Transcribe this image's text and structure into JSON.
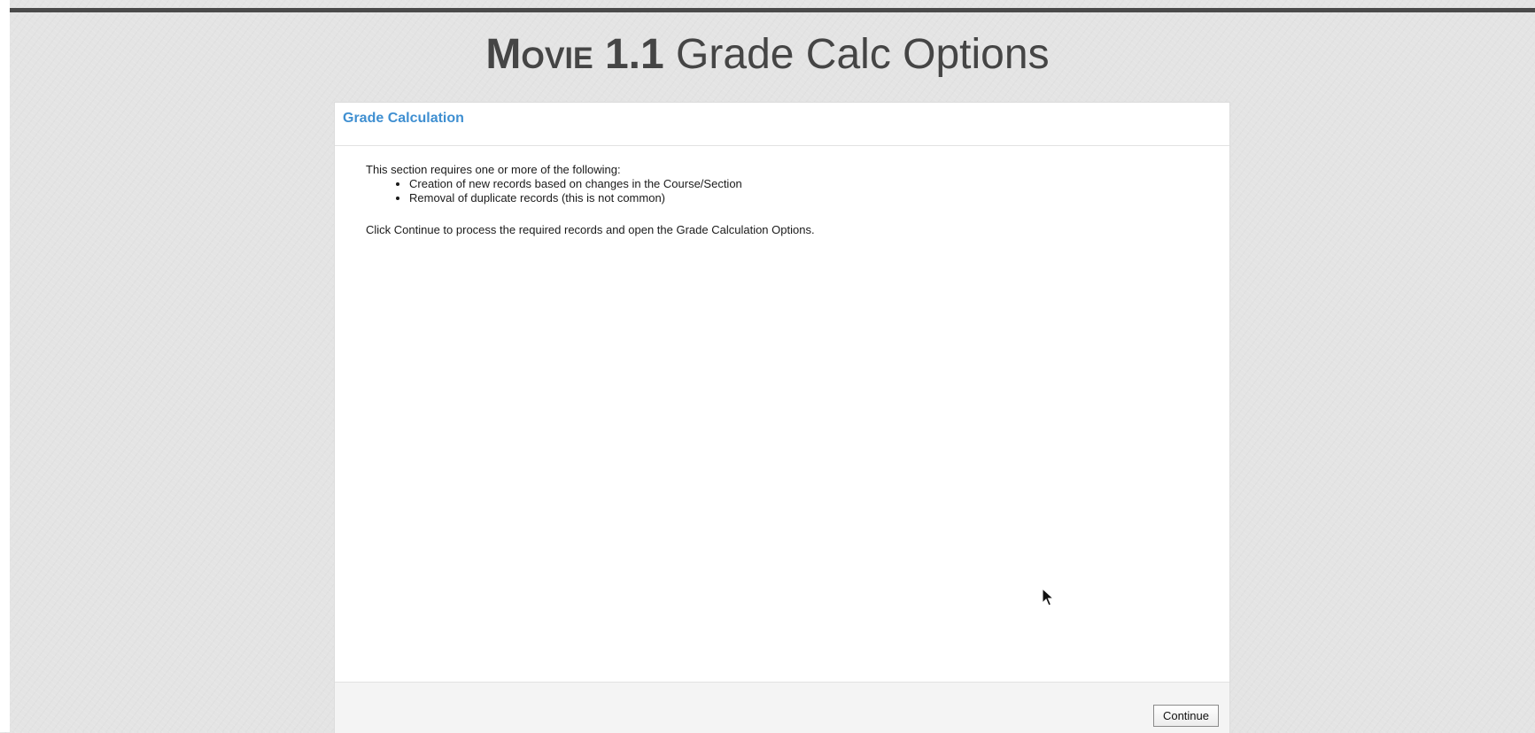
{
  "header": {
    "movie_label": "Movie 1.1",
    "title": "Grade Calc Options"
  },
  "dialog": {
    "title": "Grade Calculation",
    "intro": "This section requires one or more of the following:",
    "items": [
      "Creation of new records based on changes in the Course/Section",
      "Removal of duplicate records (this is not common)"
    ],
    "message": "Click Continue to process the required records and open the Grade Calculation Options.",
    "continue_label": "Continue"
  },
  "icons": {
    "cursor": "mouse-pointer-icon"
  },
  "colors": {
    "page_background": "#e4e4e4",
    "title_text": "#454545",
    "dialog_title": "#3f8fd1",
    "top_rule": "#4a4a4a"
  }
}
